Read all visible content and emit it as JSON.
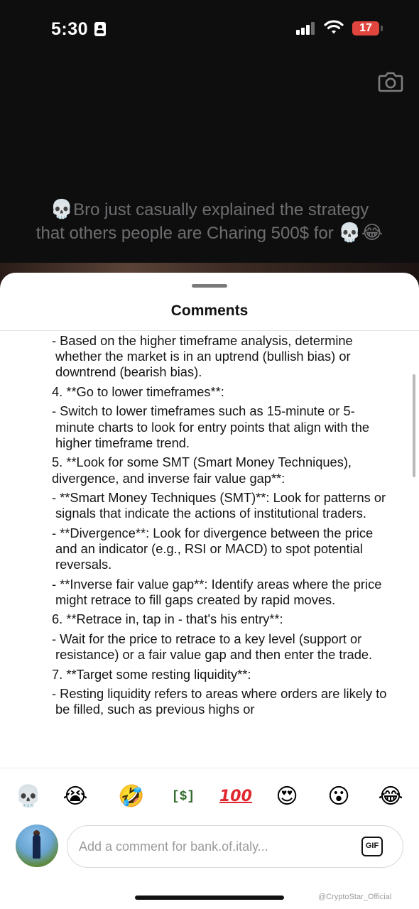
{
  "status_bar": {
    "time": "5:30",
    "battery": "17"
  },
  "video": {
    "caption_line1": "Bro just casually explained the strategy",
    "caption_line2": "that others people are Charing 500$ for",
    "caption_lead_emoji": "💀",
    "caption_trail_emoji_1": "💀",
    "caption_trail_emoji_2": "😂"
  },
  "sheet": {
    "title": "Comments"
  },
  "comment": {
    "lines": [
      {
        "text": " - Based on the higher timeframe analysis, determine whether the market is in an uptrend (bullish bias) or downtrend (bearish bias).",
        "kind": "sub"
      },
      {
        "text": "4. **Go to lower timeframes**:",
        "kind": "head"
      },
      {
        "text": " - Switch to lower timeframes such as 15-minute or 5-minute charts to look for entry points that align with the higher timeframe trend.",
        "kind": "sub"
      },
      {
        "text": "5. **Look for some SMT (Smart Money Techniques), divergence, and inverse fair value gap**:",
        "kind": "head"
      },
      {
        "text": " - **Smart Money Techniques (SMT)**: Look for patterns or signals that indicate the actions of institutional traders.",
        "kind": "sub"
      },
      {
        "text": " - **Divergence**: Look for divergence between the price and an indicator (e.g., RSI or MACD) to spot potential reversals.",
        "kind": "sub"
      },
      {
        "text": " - **Inverse fair value gap**: Identify areas where the price might retrace to fill gaps created by rapid moves.",
        "kind": "sub"
      },
      {
        "text": "6. **Retrace in, tap in - that's his entry**:",
        "kind": "head"
      },
      {
        "text": " - Wait for the price to retrace to a key level (support or resistance) or a fair value gap and then enter the trade.",
        "kind": "sub"
      },
      {
        "text": "7. **Target some resting liquidity**:",
        "kind": "head"
      },
      {
        "text": " - Resting liquidity refers to areas where orders are likely to be filled, such as previous highs or",
        "kind": "sub"
      }
    ]
  },
  "reactions": [
    {
      "name": "skull",
      "glyph": "💀"
    },
    {
      "name": "loudly-crying",
      "glyph": "😭"
    },
    {
      "name": "rofl",
      "glyph": "🤣"
    },
    {
      "name": "dollar-bill",
      "glyph": "[$]"
    },
    {
      "name": "hundred-points",
      "glyph": "100"
    },
    {
      "name": "heart-eyes",
      "glyph": "😍"
    },
    {
      "name": "astonished",
      "glyph": "😮"
    },
    {
      "name": "tears-of-joy",
      "glyph": "😂"
    }
  ],
  "composer": {
    "placeholder": "Add a comment for bank.of.italy...",
    "gif_label": "GIF"
  },
  "watermark": "@CryptoStar_Official",
  "colors": {
    "battery_low": "#e0463e",
    "backdrop": "#0e0e0f",
    "caption_text": "#6e6e70"
  }
}
